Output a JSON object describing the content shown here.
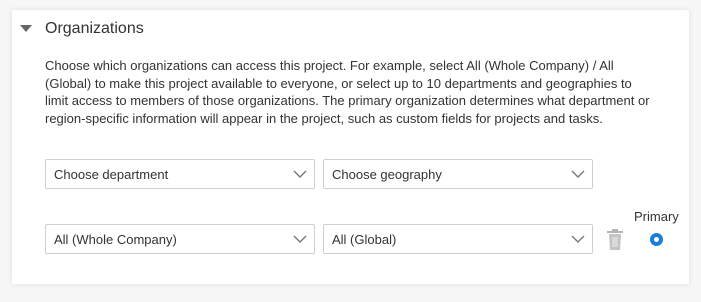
{
  "section": {
    "title": "Organizations",
    "description": "Choose which organizations can access this project. For example, select All (Whole Company) / All (Global) to make this project available to everyone, or select up to 10 departments and geographies to limit access to members of those organizations. The primary organization determines what department or region-specific information will appear in the project, such as custom fields for projects and tasks."
  },
  "new_row": {
    "department_placeholder": "Choose department",
    "geography_placeholder": "Choose geography"
  },
  "org_row": {
    "department_value": "All (Whole Company)",
    "geography_value": "All (Global)",
    "primary_label": "Primary",
    "primary_selected": true
  },
  "colors": {
    "accent": "#1a7fd9",
    "border": "#cfcfcf",
    "text": "#333333"
  },
  "icons": [
    "collapse-caret-icon",
    "chevron-down-icon",
    "trash-icon",
    "radio-selected-icon"
  ]
}
